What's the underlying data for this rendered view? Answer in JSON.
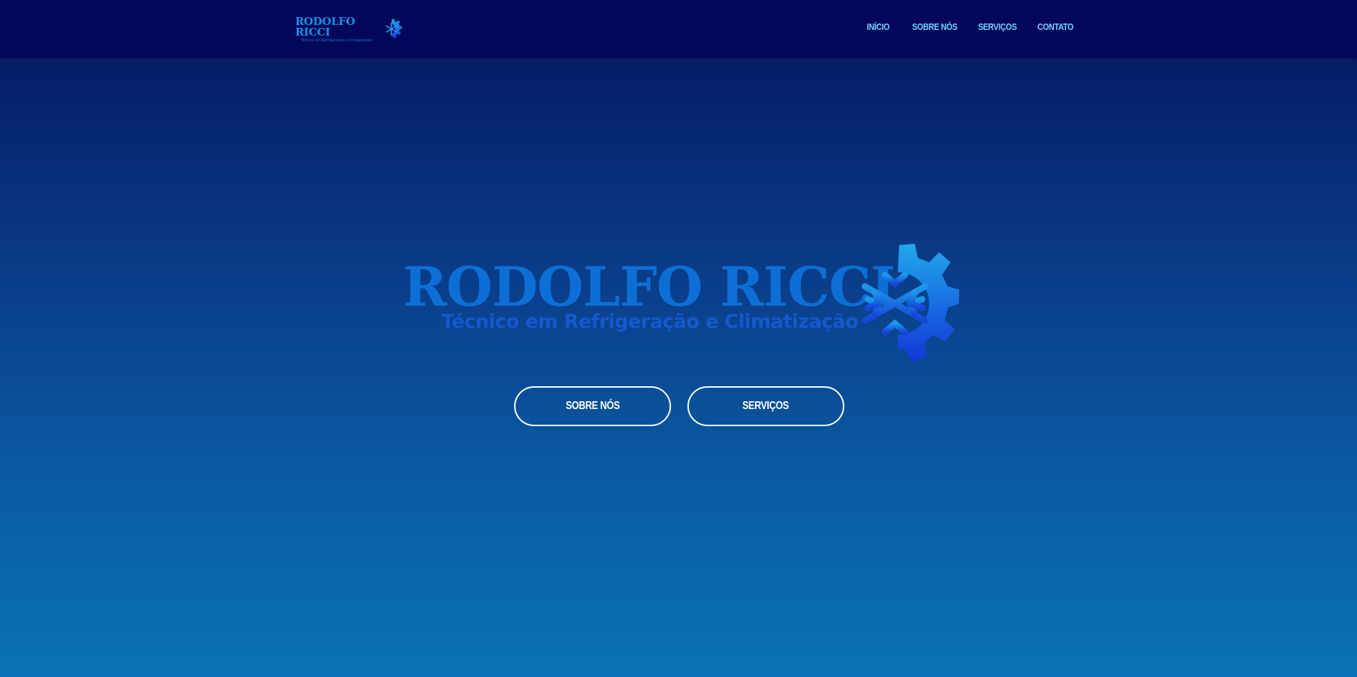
{
  "brand": {
    "name": "RODOLFO RICCI",
    "tagline": "Técnico em Refrigeração e Climatização"
  },
  "nav": {
    "items": [
      "INÍCIO",
      "SOBRE NÓS",
      "SERVIÇOS",
      "CONTATO"
    ]
  },
  "hero": {
    "title": "RODOLFO RICCI",
    "subtitle": "Técnico em Refrigeração e Climatização",
    "buttons": {
      "about": "SOBRE NÓS",
      "services": "SERVIÇOS"
    }
  },
  "colors": {
    "topbar": "#03075a",
    "nav_link": "#6fd0ff",
    "logo_blue": "#0d6fd6",
    "button_border": "#ffffff"
  },
  "icons": {
    "logo_mark": "snowflake-gear-icon"
  }
}
